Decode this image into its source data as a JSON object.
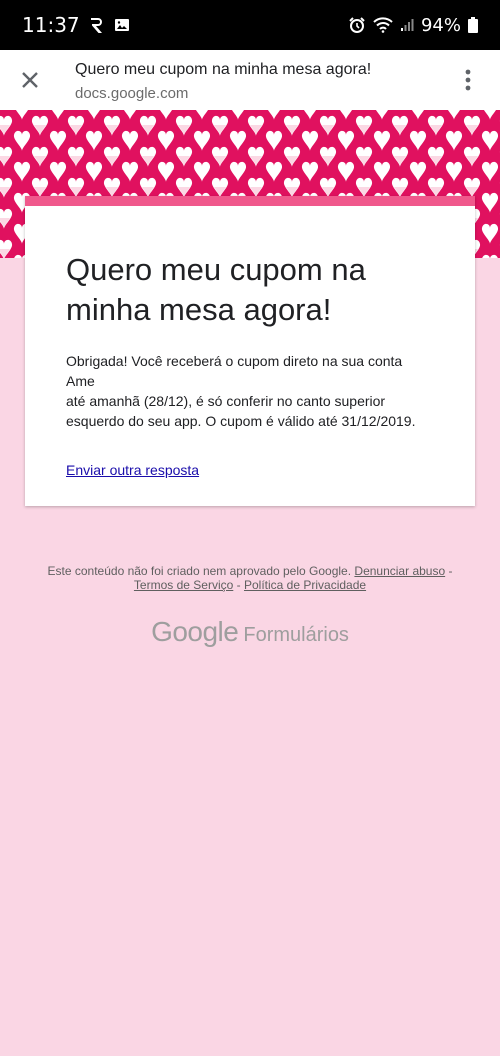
{
  "status_bar": {
    "time": "11:37",
    "battery": "94%"
  },
  "app_bar": {
    "title": "Quero meu cupom na minha mesa agora!",
    "url": "docs.google.com"
  },
  "form": {
    "title_line1": "Quero meu cupom na",
    "title_line2": "minha mesa agora!",
    "message_line1": "Obrigada! Você receberá o cupom direto na sua conta Ame",
    "message_line2": "até amanhã (28/12), é só conferir no canto superior",
    "message_line3": "esquerdo do seu app. O cupom é válido até 31/12/2019.",
    "another_response_link": "Enviar outra resposta"
  },
  "footer": {
    "disclaimer": "Este conteúdo não foi criado nem aprovado pelo Google.",
    "report_abuse": "Denunciar abuso",
    "terms": "Termos de Serviço",
    "privacy": "Política de Privacidade",
    "sep": "-",
    "logo_google": "Google",
    "logo_product": "Formulários"
  },
  "colors": {
    "banner": "#e0115f",
    "card_accent": "#f0588c",
    "page_background": "#fad6e4"
  }
}
